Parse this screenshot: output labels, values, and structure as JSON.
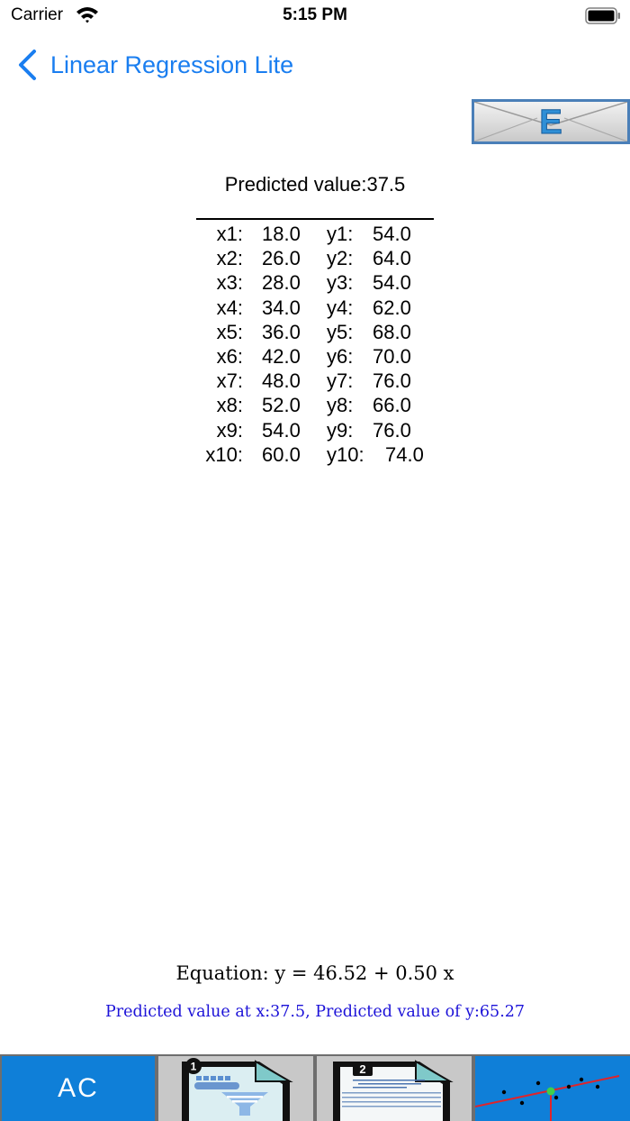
{
  "status_bar": {
    "carrier": "Carrier",
    "time": "5:15 PM"
  },
  "nav": {
    "back_label": "Linear Regression Lite"
  },
  "email_button": {
    "letter": "E"
  },
  "predicted_header": "Predicted value:37.5",
  "data_points": [
    {
      "x_label": "x1:",
      "x": "18.0",
      "y_label": "y1:",
      "y": "54.0"
    },
    {
      "x_label": "x2:",
      "x": "26.0",
      "y_label": "y2:",
      "y": "64.0"
    },
    {
      "x_label": "x3:",
      "x": "28.0",
      "y_label": "y3:",
      "y": "54.0"
    },
    {
      "x_label": "x4:",
      "x": "34.0",
      "y_label": "y4:",
      "y": "62.0"
    },
    {
      "x_label": "x5:",
      "x": "36.0",
      "y_label": "y5:",
      "y": "68.0"
    },
    {
      "x_label": "x6:",
      "x": "42.0",
      "y_label": "y6:",
      "y": "70.0"
    },
    {
      "x_label": "x7:",
      "x": "48.0",
      "y_label": "y7:",
      "y": "76.0"
    },
    {
      "x_label": "x8:",
      "x": "52.0",
      "y_label": "y8:",
      "y": "66.0"
    },
    {
      "x_label": "x9:",
      "x": "54.0",
      "y_label": "y9:",
      "y": "76.0"
    },
    {
      "x_label": "x10:",
      "x": "60.0",
      "y_label": "y10:",
      "y": "74.0"
    }
  ],
  "equation": "Equation: y = 46.52 + 0.50 x",
  "prediction_text": "Predicted value at x:37.5, Predicted value of y:65.27",
  "toolbar": {
    "ac_label": "AC",
    "doc1_badge": "1",
    "doc2_badge": "2"
  },
  "colors": {
    "accent": "#1a7ef0",
    "toolbar_blue": "#0f7fd8",
    "prediction_text": "#1c12d8"
  }
}
